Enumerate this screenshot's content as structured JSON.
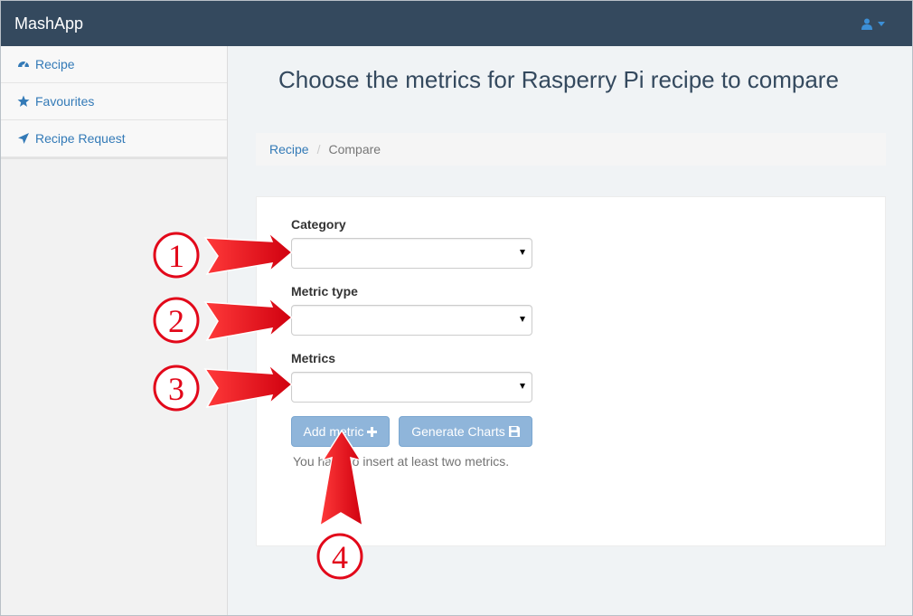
{
  "app": {
    "name": "MashApp"
  },
  "navbar": {
    "user_icon": "user-icon",
    "dropdown_icon": "caret-down-icon"
  },
  "sidebar": {
    "items": [
      {
        "label": "Recipe",
        "icon": "dashboard-icon"
      },
      {
        "label": "Favourites",
        "icon": "star-icon"
      },
      {
        "label": "Recipe Request",
        "icon": "paper-plane-icon"
      }
    ]
  },
  "page": {
    "title": "Choose the metrics for Rasperry Pi recipe to compare",
    "breadcrumb": [
      {
        "label": "Recipe",
        "link": true
      },
      {
        "label": "Compare",
        "link": false
      }
    ],
    "breadcrumb_separator": "/"
  },
  "form": {
    "category": {
      "label": "Category",
      "value": ""
    },
    "metric_type": {
      "label": "Metric type",
      "value": ""
    },
    "metrics": {
      "label": "Metrics",
      "value": ""
    },
    "add_metric_label": "Add metric",
    "add_metric_icon": "plus-icon",
    "generate_charts_label": "Generate Charts",
    "generate_charts_icon": "floppy-disk-icon",
    "help_text": "You have to insert at least two metrics."
  },
  "annotations": {
    "markers": [
      "1",
      "2",
      "3",
      "4"
    ],
    "color": "#e2081a"
  },
  "colors": {
    "navbar": "#34495e",
    "link": "#337ab7",
    "button": "#8fb5da",
    "title": "#34495e"
  }
}
